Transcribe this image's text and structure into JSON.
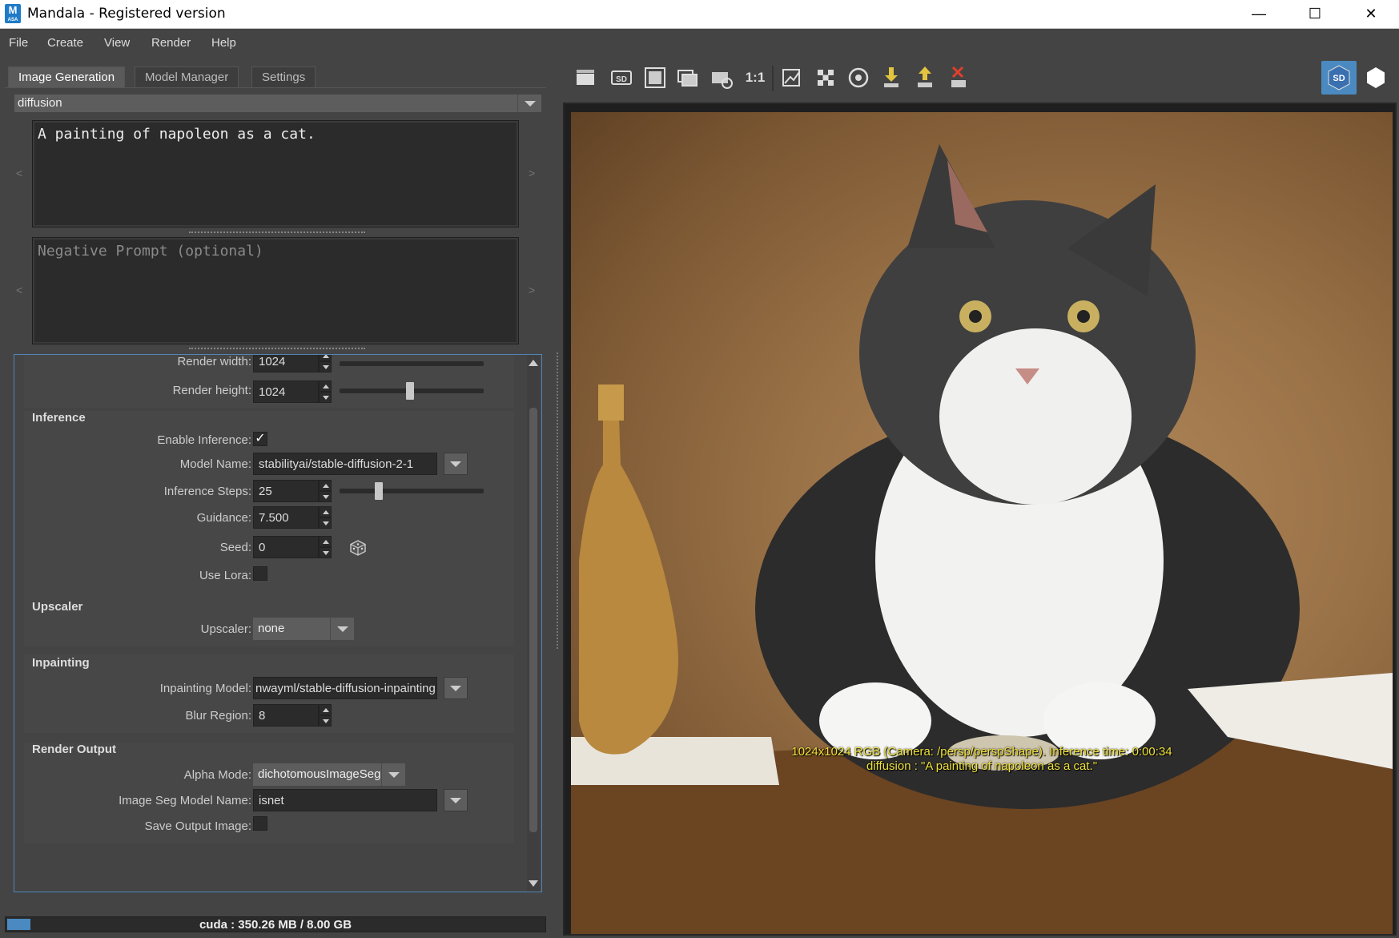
{
  "window": {
    "title": "Mandala - Registered version",
    "icon_letter": "M",
    "icon_sub": "ASA"
  },
  "menu": [
    "File",
    "Create",
    "View",
    "Render",
    "Help"
  ],
  "tabs": [
    "Image Generation",
    "Model Manager",
    "Settings"
  ],
  "preset": "diffusion",
  "prompt": {
    "value": "A painting of napoleon as a cat.",
    "negative_placeholder": "Negative Prompt (optional)",
    "left_arrow": "<",
    "right_arrow": ">"
  },
  "render": {
    "width_label": "Render width:",
    "width_value": "1024",
    "height_label": "Render height:",
    "height_value": "1024"
  },
  "inference": {
    "header": "Inference",
    "enable_label": "Enable Inference:",
    "enable_checked": "✓",
    "model_label": "Model Name:",
    "model_value": "stabilityai/stable-diffusion-2-1",
    "steps_label": "Inference Steps:",
    "steps_value": "25",
    "guidance_label": "Guidance:",
    "guidance_value": "7.500",
    "seed_label": "Seed:",
    "seed_value": "0",
    "lora_label": "Use Lora:"
  },
  "upscaler": {
    "header": "Upscaler",
    "label": "Upscaler:",
    "value": "none"
  },
  "inpainting": {
    "header": "Inpainting",
    "model_label": "Inpainting Model:",
    "model_value": "nwayml/stable-diffusion-inpainting",
    "blur_label": "Blur Region:",
    "blur_value": "8"
  },
  "output": {
    "header": "Render Output",
    "alpha_label": "Alpha Mode:",
    "alpha_value": "dichotomousImageSeg",
    "seg_label": "Image Seg Model Name:",
    "seg_value": "isnet",
    "save_label": "Save Output Image:"
  },
  "status": {
    "text": "cuda : 350.26 MB / 8.00 GB",
    "memory_fraction": 0.0428
  },
  "toolbar": {
    "ratio_label": "1:1",
    "icons": [
      "clapboard-icon",
      "sd-icon",
      "frame-icon",
      "layers-icon",
      "render-settings-icon",
      "image-edit-icon",
      "checker-icon",
      "aperture-icon",
      "import-icon",
      "export-icon",
      "delete-icon",
      "sd-cube-icon",
      "hexagon-icon"
    ]
  },
  "viewport": {
    "info_line1": "1024x1024 RGB (Camera: /persp/perspShape). Inference time: 0:00:34",
    "info_line2": "diffusion : \"A painting of napoleon as a cat.\""
  },
  "colors": {
    "accent": "#4a8ac0",
    "overlay_text": "#f0e23a",
    "panel": "#444444"
  }
}
